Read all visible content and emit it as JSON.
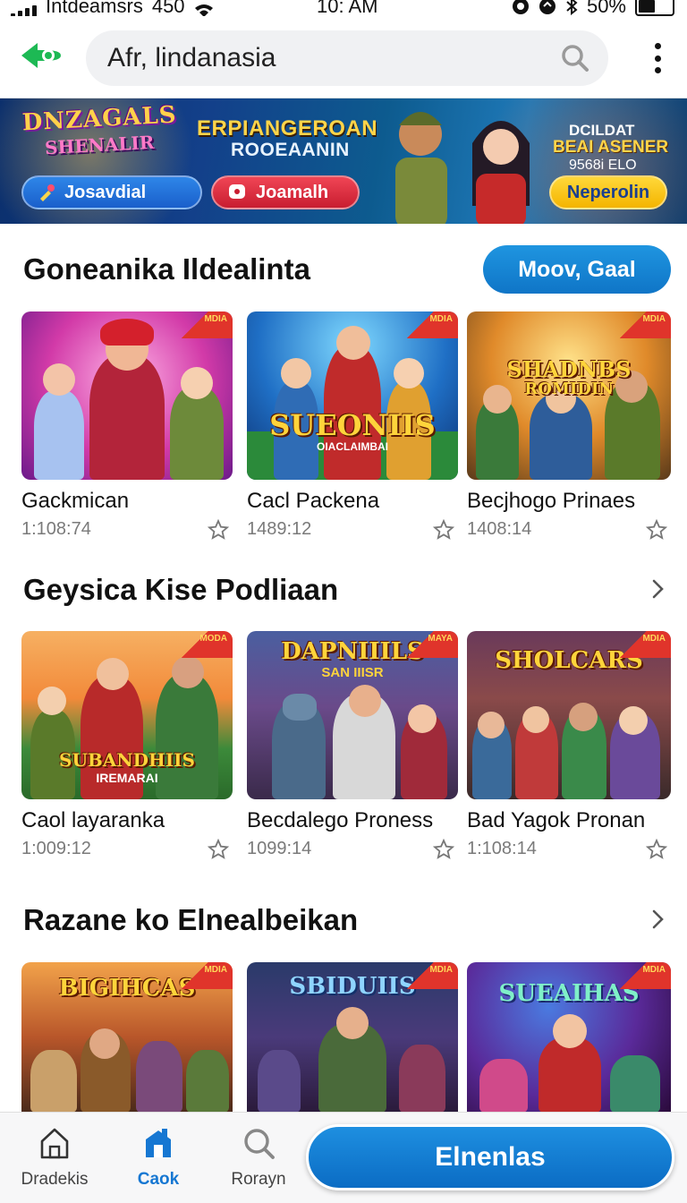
{
  "status_bar": {
    "carrier": "Intdeamsrs",
    "network": "450",
    "time": "10: AM",
    "battery": "50%",
    "battery_level": 0.5
  },
  "top_bar": {
    "search_value": "Afr, lindanasia"
  },
  "banner": {
    "logo_line1": "DNZAGALS",
    "logo_line2": "SHENALIR",
    "title": "ERPIANGEROAN",
    "subtitle": "ROOEAANIN",
    "right_line1": "DCILDAT",
    "right_line2": "BEAI ASENER",
    "right_line3": "9568i ELO",
    "buttons": [
      "Josavdial",
      "Joamalh",
      "Neperolin"
    ]
  },
  "sections": [
    {
      "title": "Goneanika Ildealinta",
      "more_label": "Moov, Gaal",
      "cards": [
        {
          "name": "Gackmican",
          "duration": "1:108:74",
          "art_title": "",
          "art_sub": "",
          "badge": "MDIA"
        },
        {
          "name": "Cacl Packena",
          "duration": "1489:12",
          "art_title": "SUEONIIS",
          "art_sub": "OIACLAIMBAI",
          "badge": "MDIA"
        },
        {
          "name": "Becjhogo Prinaes",
          "duration": "1408:14",
          "art_title": "SHADNBS",
          "art_sub": "ROMIDIN",
          "badge": "MDIA"
        }
      ]
    },
    {
      "title": "Geysica Kise Podliaan",
      "cards": [
        {
          "name": "Caol layaranka",
          "duration": "1:009:12",
          "art_title": "SUBANDHIIS",
          "art_sub": "IREMARAI",
          "badge": "MODA"
        },
        {
          "name": "Becdalego Proness",
          "duration": "1099:14",
          "art_title": "DAPNIIILS",
          "art_sub": "SAN IIISR",
          "badge": "MAYA"
        },
        {
          "name": "Bad Yagok Pronan",
          "duration": "1:108:14",
          "art_title": "SHOLCARS",
          "art_sub": "",
          "badge": "MDIA"
        }
      ]
    },
    {
      "title": "Razane ko Elnealbeikan",
      "cards": [
        {
          "name": "",
          "duration": "",
          "art_title": "BIGIHCAS",
          "art_sub": "",
          "badge": "MDIA"
        },
        {
          "name": "",
          "duration": "",
          "art_title": "SBIDUIIS",
          "art_sub": "",
          "badge": "MDIA"
        },
        {
          "name": "",
          "duration": "",
          "art_title": "SUEAIHAS",
          "art_sub": "",
          "badge": "MDIA"
        }
      ]
    }
  ],
  "bottom_nav": {
    "items": [
      {
        "label": "Dradekis",
        "icon": "home-icon"
      },
      {
        "label": "Caok",
        "icon": "store-icon"
      },
      {
        "label": "Rorayn",
        "icon": "search-icon"
      }
    ],
    "cta_label": "Elnenlas"
  },
  "colors": {
    "accent": "#1677d2",
    "cta": "#0b6cc4",
    "logo_green": "#1db954"
  }
}
